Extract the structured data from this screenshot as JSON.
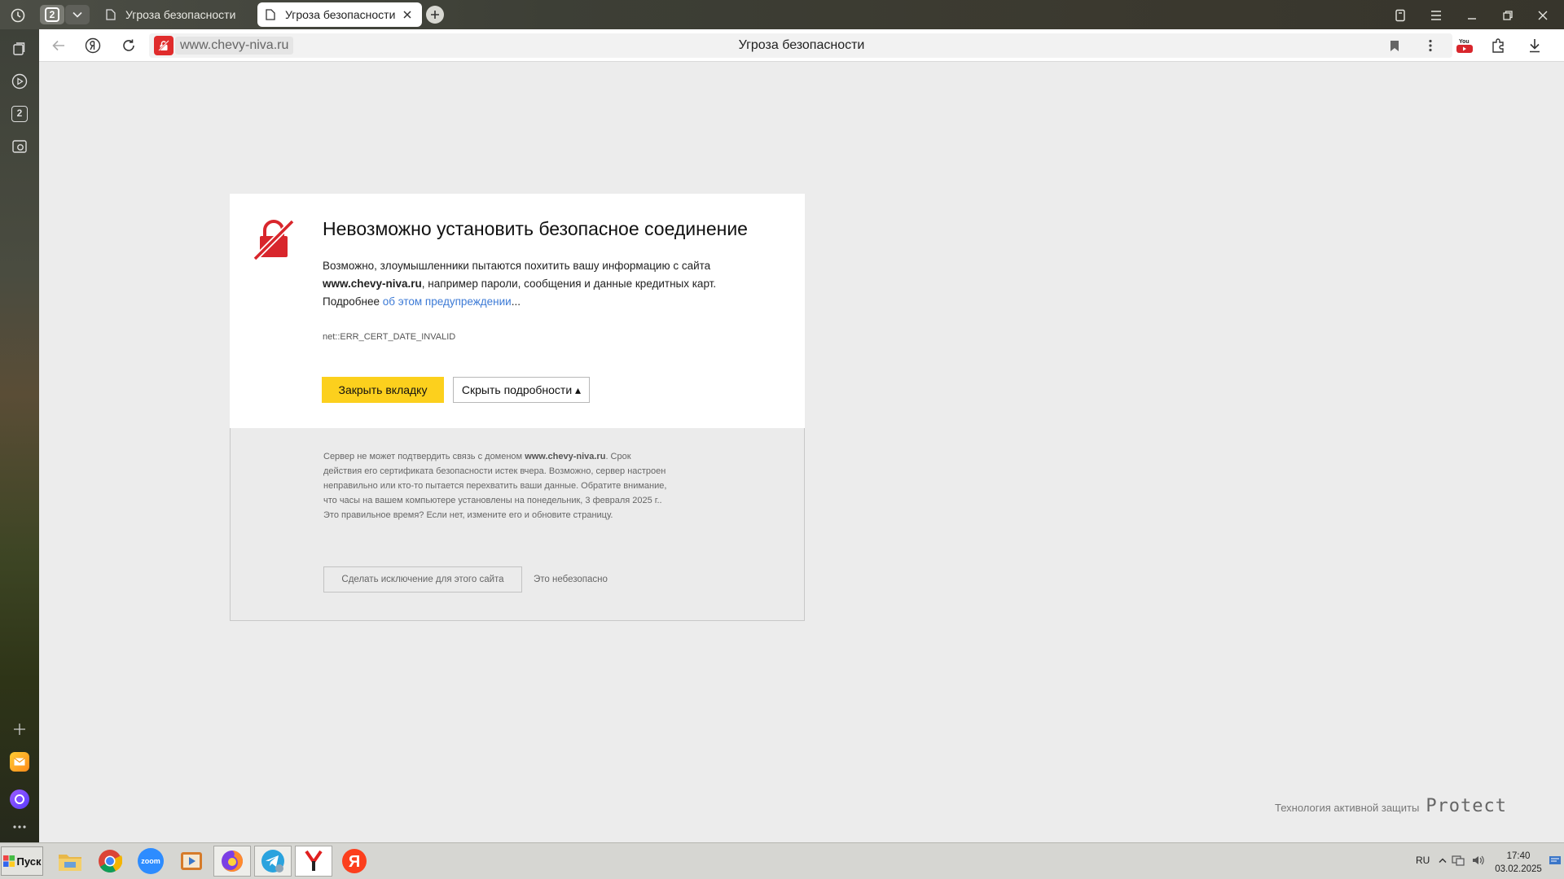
{
  "browser": {
    "tab_count": "2",
    "tabs": [
      {
        "label": "Угроза безопасности",
        "active": false
      },
      {
        "label": "Угроза безопасности",
        "active": true
      }
    ],
    "url": "www.chevy-niva.ru",
    "page_title": "Угроза безопасности",
    "sidebar_badge": "2"
  },
  "warning": {
    "title": "Невозможно установить безопасное соединение",
    "desc_prefix": "Возможно, злоумышленники пытаются похитить вашу информацию с сайта",
    "site": "www.chevy-niva.ru",
    "desc_suffix": ", например пароли, сообщения и данные кредитных карт.",
    "more_prefix": "Подробнее ",
    "more_link": "об этом предупреждении",
    "more_suffix": "...",
    "error_code": "net::ERR_CERT_DATE_INVALID",
    "close_button": "Закрыть вкладку",
    "hide_button": "Скрыть подробности ▴"
  },
  "details": {
    "text_1": "Сервер не может подтвердить связь с доменом ",
    "domain": "www.chevy-niva.ru",
    "text_2": ". Срок действия его сертификата безопасности истек вчера. Возможно, сервер настроен неправильно или кто-то пытается перехватить ваши данные. Обратите внимание, что часы на вашем компьютере установлены на понедельник, 3 февраля 2025 г.. Это правильное время? Если нет, измените его и обновите страницу.",
    "exception_button": "Сделать исключение для этого сайта",
    "unsafe_note": "Это небезопасно"
  },
  "footer": {
    "protect_text": "Технология активной защиты",
    "protect_brand": "Protect"
  },
  "taskbar": {
    "start_label": "Пуск",
    "apps": [
      "file-explorer",
      "google-chrome",
      "zoom",
      "media-player",
      "firefox",
      "telegram",
      "yandex-browser",
      "yandex"
    ],
    "zoom_label": "zoom",
    "language": "RU",
    "time": "17:40",
    "date": "03.02.2025"
  },
  "colors": {
    "accent_yellow": "#fcd01d",
    "danger_red": "#d8262c",
    "link_blue": "#3c7ad6"
  }
}
